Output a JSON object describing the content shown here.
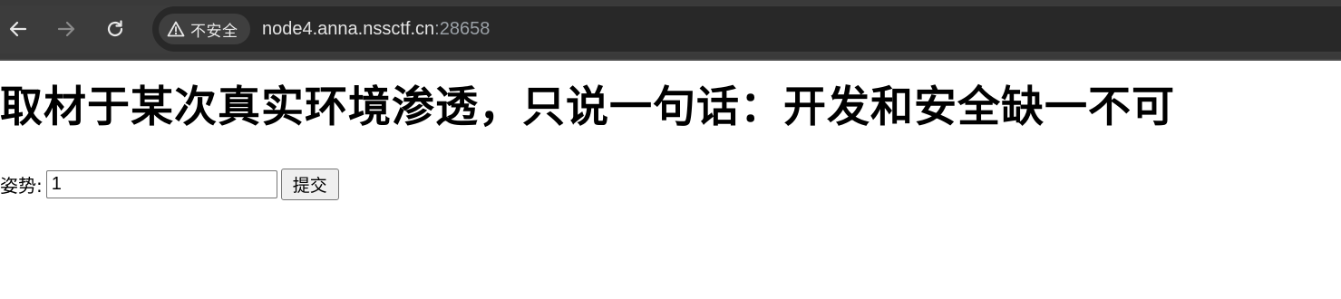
{
  "browser": {
    "address_bar": {
      "security_label": "不安全",
      "url_host": "node4.anna.nssctf.cn",
      "url_port": ":28658"
    },
    "icons": {
      "back": "arrow-left-icon",
      "forward": "arrow-right-icon",
      "reload": "reload-icon",
      "security": "warning-triangle-icon"
    },
    "colors": {
      "toolbar_bg": "#3c3c3c",
      "omnibox_bg": "#282828",
      "chip_bg": "#3f3f3f"
    }
  },
  "page": {
    "title": "取材于某次真实环境渗透，只说一句话：开发和安全缺一不可",
    "form": {
      "label": "姿势:",
      "input_value": "1",
      "submit_label": "提交"
    }
  }
}
